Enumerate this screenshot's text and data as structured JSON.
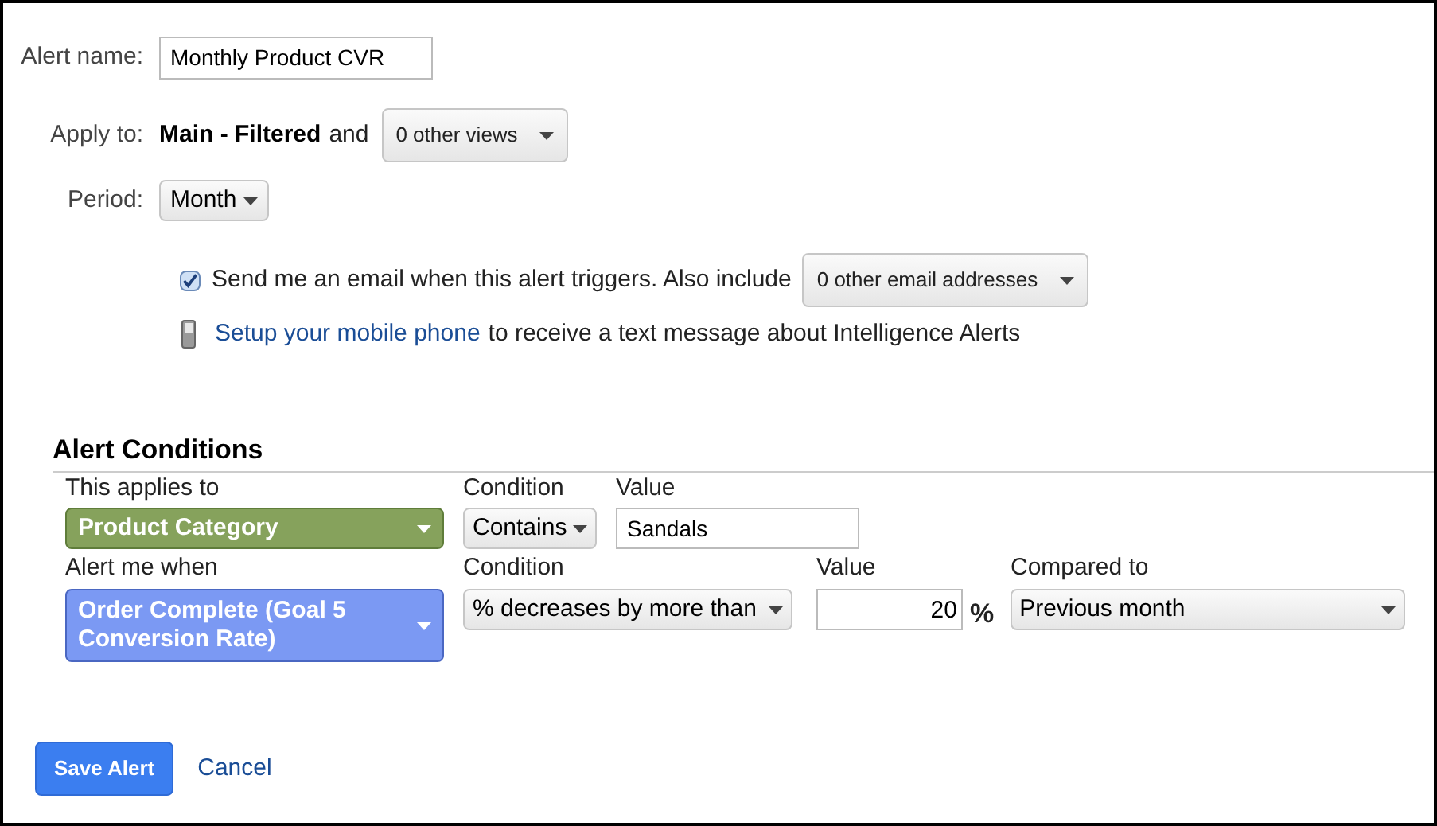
{
  "alert_name": {
    "label": "Alert name:",
    "value": "Monthly Product CVR"
  },
  "apply_to": {
    "label": "Apply to:",
    "view": "Main - Filtered",
    "connector": "and",
    "dropdown": "0 other views"
  },
  "period": {
    "label": "Period:",
    "value": "Month"
  },
  "email": {
    "checked": true,
    "text": "Send me an email when this alert triggers. Also include",
    "dropdown": "0 other email addresses"
  },
  "mobile": {
    "link": "Setup your mobile phone",
    "text": "to receive a text message about Intelligence Alerts"
  },
  "conditions": {
    "title": "Alert Conditions",
    "filter": {
      "label": "This applies to",
      "dimension": "Product Category",
      "color": "#86a25c",
      "condition_label": "Condition",
      "condition": "Contains",
      "value_label": "Value",
      "value": "Sandals"
    },
    "alert": {
      "label": "Alert me when",
      "metric": "Order Complete (Goal 5 Conversion Rate)",
      "color": "#7b99f3",
      "condition_label": "Condition",
      "condition": "% decreases by more than",
      "value_label": "Value",
      "value": "20",
      "unit": "%",
      "compare_label": "Compared to",
      "compare": "Previous month"
    }
  },
  "buttons": {
    "save": "Save Alert",
    "cancel": "Cancel"
  }
}
